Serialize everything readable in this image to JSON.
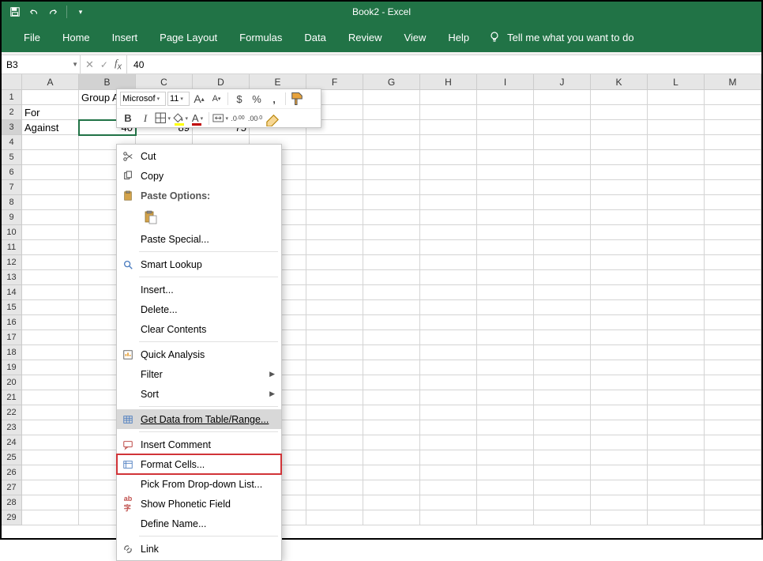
{
  "app": {
    "title": "Book2 - Excel"
  },
  "tabs": [
    "File",
    "Home",
    "Insert",
    "Page Layout",
    "Formulas",
    "Data",
    "Review",
    "View",
    "Help"
  ],
  "tell_me": "Tell me what you want to do",
  "name_box": "B3",
  "formula_value": "40",
  "columns": [
    "A",
    "B",
    "C",
    "D",
    "E",
    "F",
    "G",
    "H",
    "I",
    "J",
    "K",
    "L",
    "M"
  ],
  "row_count": 29,
  "sheet": {
    "r1": {
      "B": "Group A"
    },
    "r2": {
      "A": "For"
    },
    "r3": {
      "A": "Against",
      "B": "40",
      "C": "89",
      "D": "75"
    }
  },
  "active_cell": {
    "row": 3,
    "col": "B"
  },
  "mini": {
    "font": "Microsof",
    "size": "11",
    "inc": "A",
    "dec": "A",
    "dollar": "$",
    "percent": "%",
    "comma": ",",
    "bold": "B",
    "italic": "I",
    "font_letter": "A",
    "dec_inc": ".00",
    "dec_dec": ".00"
  },
  "ctx": {
    "cut": "Cut",
    "copy": "Copy",
    "paste_options": "Paste Options:",
    "paste_special": "Paste Special...",
    "smart_lookup": "Smart Lookup",
    "insert": "Insert...",
    "delete": "Delete...",
    "clear": "Clear Contents",
    "quick": "Quick Analysis",
    "filter": "Filter",
    "sort": "Sort",
    "get_data": "Get Data from Table/Range...",
    "comment": "Insert Comment",
    "format": "Format Cells...",
    "pick": "Pick From Drop-down List...",
    "phonetic": "Show Phonetic Field",
    "define": "Define Name...",
    "link": "Link"
  }
}
